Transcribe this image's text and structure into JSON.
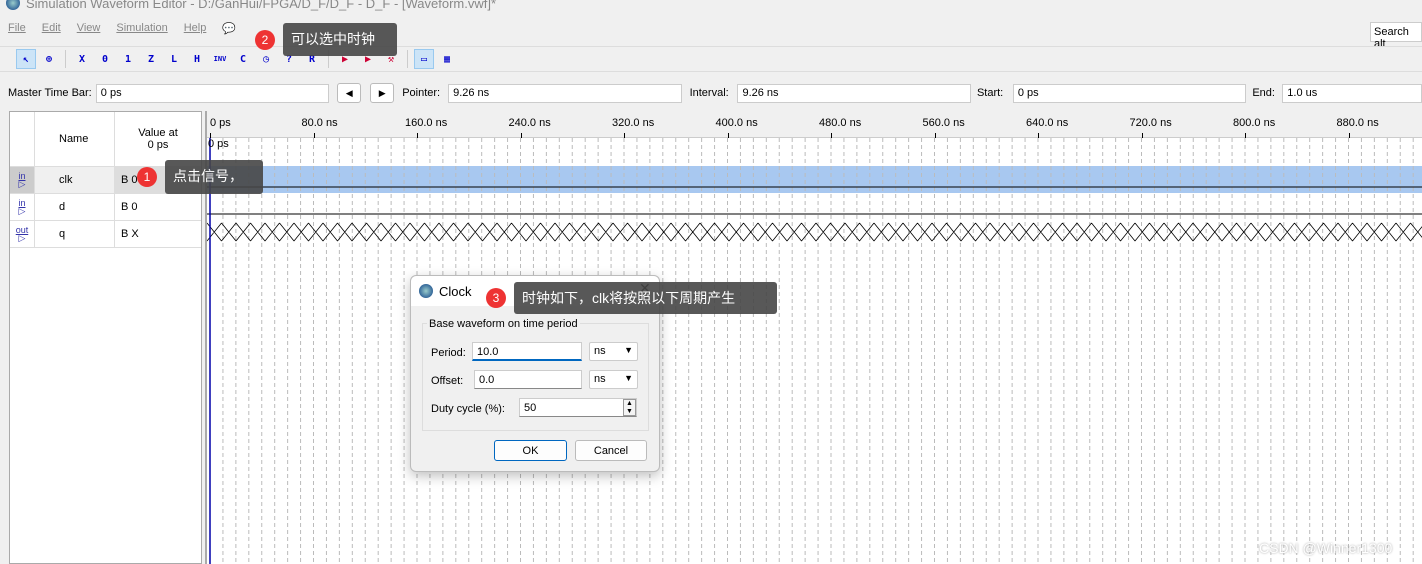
{
  "window": {
    "title": "Simulation Waveform Editor - D:/GanHui/FPGA/D_F/D_F - D_F - [Waveform.vwf]*"
  },
  "menu": [
    "File",
    "Edit",
    "View",
    "Simulation",
    "Help"
  ],
  "search": {
    "placeholder": "Search alt"
  },
  "toolbar": [
    {
      "icon": "selection-tool-icon",
      "glyph": "↖",
      "selected": true
    },
    {
      "icon": "zoom-tool-icon",
      "glyph": "⊕"
    },
    {
      "icon": "forcing-unknown-icon",
      "glyph": "X"
    },
    {
      "icon": "forcing-low-icon",
      "glyph": "0"
    },
    {
      "icon": "forcing-high-icon",
      "glyph": "1"
    },
    {
      "icon": "high-impedance-icon",
      "glyph": "Z"
    },
    {
      "icon": "weak-low-icon",
      "glyph": "L"
    },
    {
      "icon": "weak-high-icon",
      "glyph": "H"
    },
    {
      "icon": "invert-icon",
      "glyph": "INV"
    },
    {
      "icon": "count-value-icon",
      "glyph": "C"
    },
    {
      "icon": "overwrite-clock-icon",
      "glyph": "◷"
    },
    {
      "icon": "random-values-icon",
      "glyph": "?"
    },
    {
      "icon": "arbitrary-value-icon",
      "glyph": "R"
    },
    {
      "icon": "run-functional-simulation-icon",
      "glyph": "▶"
    },
    {
      "icon": "run-timing-simulation-icon",
      "glyph": "▶"
    },
    {
      "icon": "generate-netlist-icon",
      "glyph": "⚒"
    },
    {
      "icon": "snap-to-grid-icon",
      "glyph": "▭",
      "selected": true
    },
    {
      "icon": "grid-icon",
      "glyph": "▦"
    }
  ],
  "timebar": {
    "master_label": "Master Time Bar:",
    "master_value": "0 ps",
    "pointer_label": "Pointer:",
    "pointer_value": "9.26 ns",
    "interval_label": "Interval:",
    "interval_value": "9.26 ns",
    "start_label": "Start:",
    "start_value": "0 ps",
    "end_label": "End:",
    "end_value": "1.0 us"
  },
  "signals_header": {
    "name": "Name",
    "value": "Value at\n0 ps"
  },
  "signals": [
    {
      "type": "in",
      "name": "clk",
      "value": "B 0",
      "selected": true
    },
    {
      "type": "in",
      "name": "d",
      "value": "B 0"
    },
    {
      "type": "out",
      "name": "q",
      "value": "B X"
    }
  ],
  "ruler": {
    "ticks": [
      "0 ps",
      "80.0 ns",
      "160.0 ns",
      "240.0 ns",
      "320.0 ns",
      "400.0 ns",
      "480.0 ns",
      "560.0 ns",
      "640.0 ns",
      "720.0 ns",
      "800.0 ns",
      "880.0 ns"
    ],
    "marker": "0 ps"
  },
  "dialog": {
    "title": "Clock",
    "group": "Base waveform on time period",
    "period_label": "Period:",
    "period_value": "10.0",
    "period_unit": "ns",
    "offset_label": "Offset:",
    "offset_value": "0.0",
    "offset_unit": "ns",
    "duty_label": "Duty cycle (%):",
    "duty_value": "50",
    "ok": "OK",
    "cancel": "Cancel"
  },
  "annotations": [
    {
      "number": "1",
      "text": "点击信号，"
    },
    {
      "number": "2",
      "text": "可以选中时钟"
    },
    {
      "number": "3",
      "text": "时钟如下，clk将按照以下周期产生"
    }
  ],
  "watermark": "CSDN @Winner1300",
  "colors": {
    "selection": "#a8c8f0",
    "tooltip": "#464646",
    "badge": "#e33333"
  }
}
